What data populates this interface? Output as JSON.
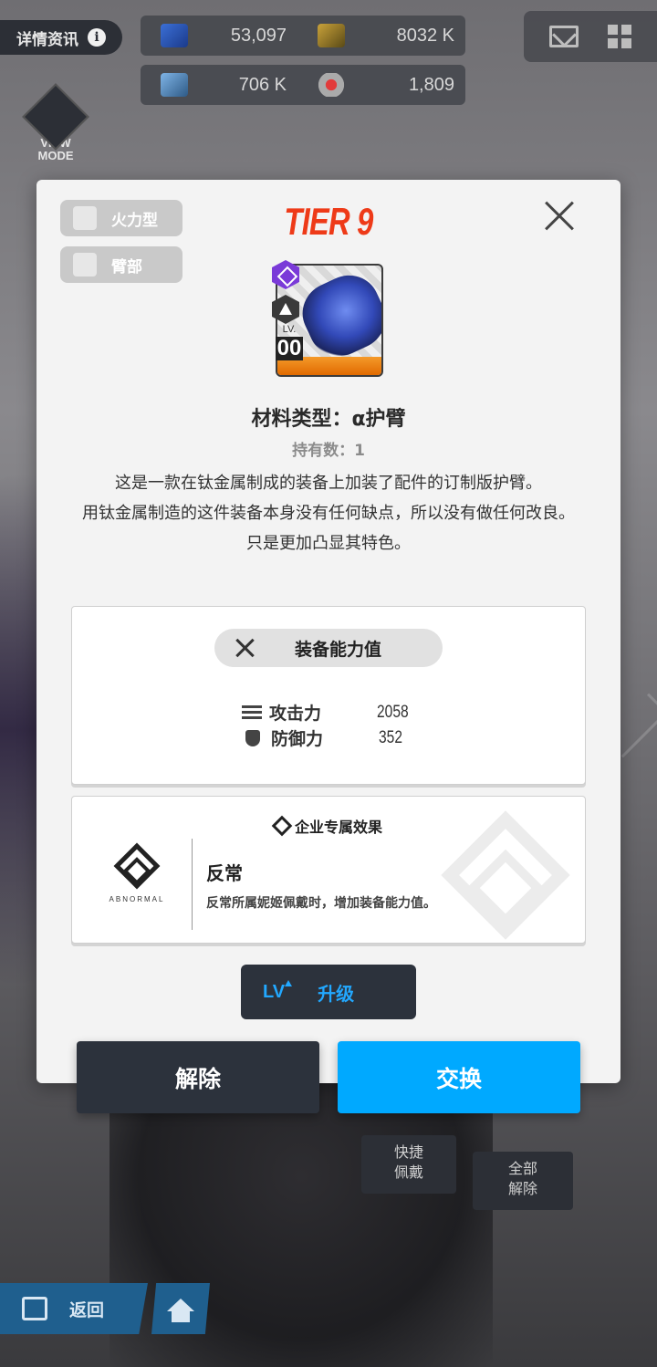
{
  "background": {
    "detail_tab_label": "详情资讯",
    "resources": [
      {
        "icon": "crystal-icon",
        "value": "53,097"
      },
      {
        "icon": "credit-icon",
        "value": "8032 K"
      },
      {
        "icon": "battle-data-icon",
        "value": "706 K"
      },
      {
        "icon": "core-dust-icon",
        "value": "1,809"
      }
    ],
    "view_mode_label": "VIEW MODE",
    "quick_equip_label": "快捷\n佩戴",
    "remove_all_label": "全部\n解除",
    "back_label": "返回"
  },
  "modal": {
    "tags": [
      {
        "icon": "firepower-icon",
        "label": "火力型"
      },
      {
        "icon": "arm-icon",
        "label": "臂部"
      }
    ],
    "tier": "TIER 9",
    "item": {
      "level_label": "LV.",
      "level_value": "00",
      "name": "材料类型：α护臂",
      "owned": "持有数：1",
      "description": [
        "这是一款在钛金属制成的装备上加装了配件的订制版护臂。",
        "用钛金属制造的这件装备本身没有任何缺点，所以没有做任何改良。",
        "只是更加凸显其特色。"
      ]
    },
    "stats": {
      "header": "装备能力值",
      "rows": [
        {
          "icon": "attack-icon",
          "label": "攻击力",
          "value": "2058"
        },
        {
          "icon": "defense-icon",
          "label": "防御力",
          "value": "352"
        }
      ]
    },
    "corp": {
      "header": "企业专属效果",
      "logo_text": "ABNORMAL",
      "name": "反常",
      "description": "反常所属妮姬佩戴时，增加装备能力值。"
    },
    "upgrade": {
      "lv_label": "LV",
      "label": "升级"
    },
    "buttons": {
      "remove": "解除",
      "swap": "交换"
    }
  },
  "colors": {
    "tier": "#ee3a18",
    "accent_blue": "#00a9ff",
    "dark_button": "#2c323c"
  }
}
